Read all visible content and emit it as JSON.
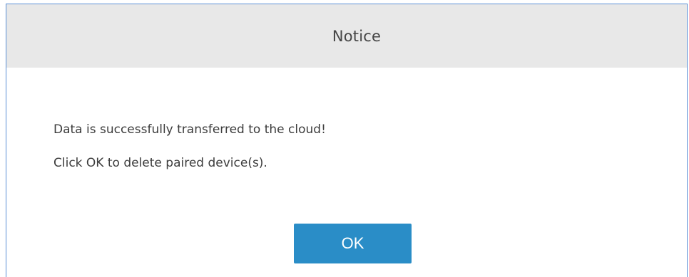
{
  "dialog": {
    "title": "Notice",
    "messages": [
      "Data is successfully transferred to the cloud!",
      "Click OK to delete paired device(s)."
    ],
    "ok_label": "OK",
    "colors": {
      "header_bg": "#e8e8e8",
      "border": "#5b8fd6",
      "button_bg": "#2a8dc7",
      "button_text": "#ffffff",
      "text": "#3c3c3c"
    }
  }
}
